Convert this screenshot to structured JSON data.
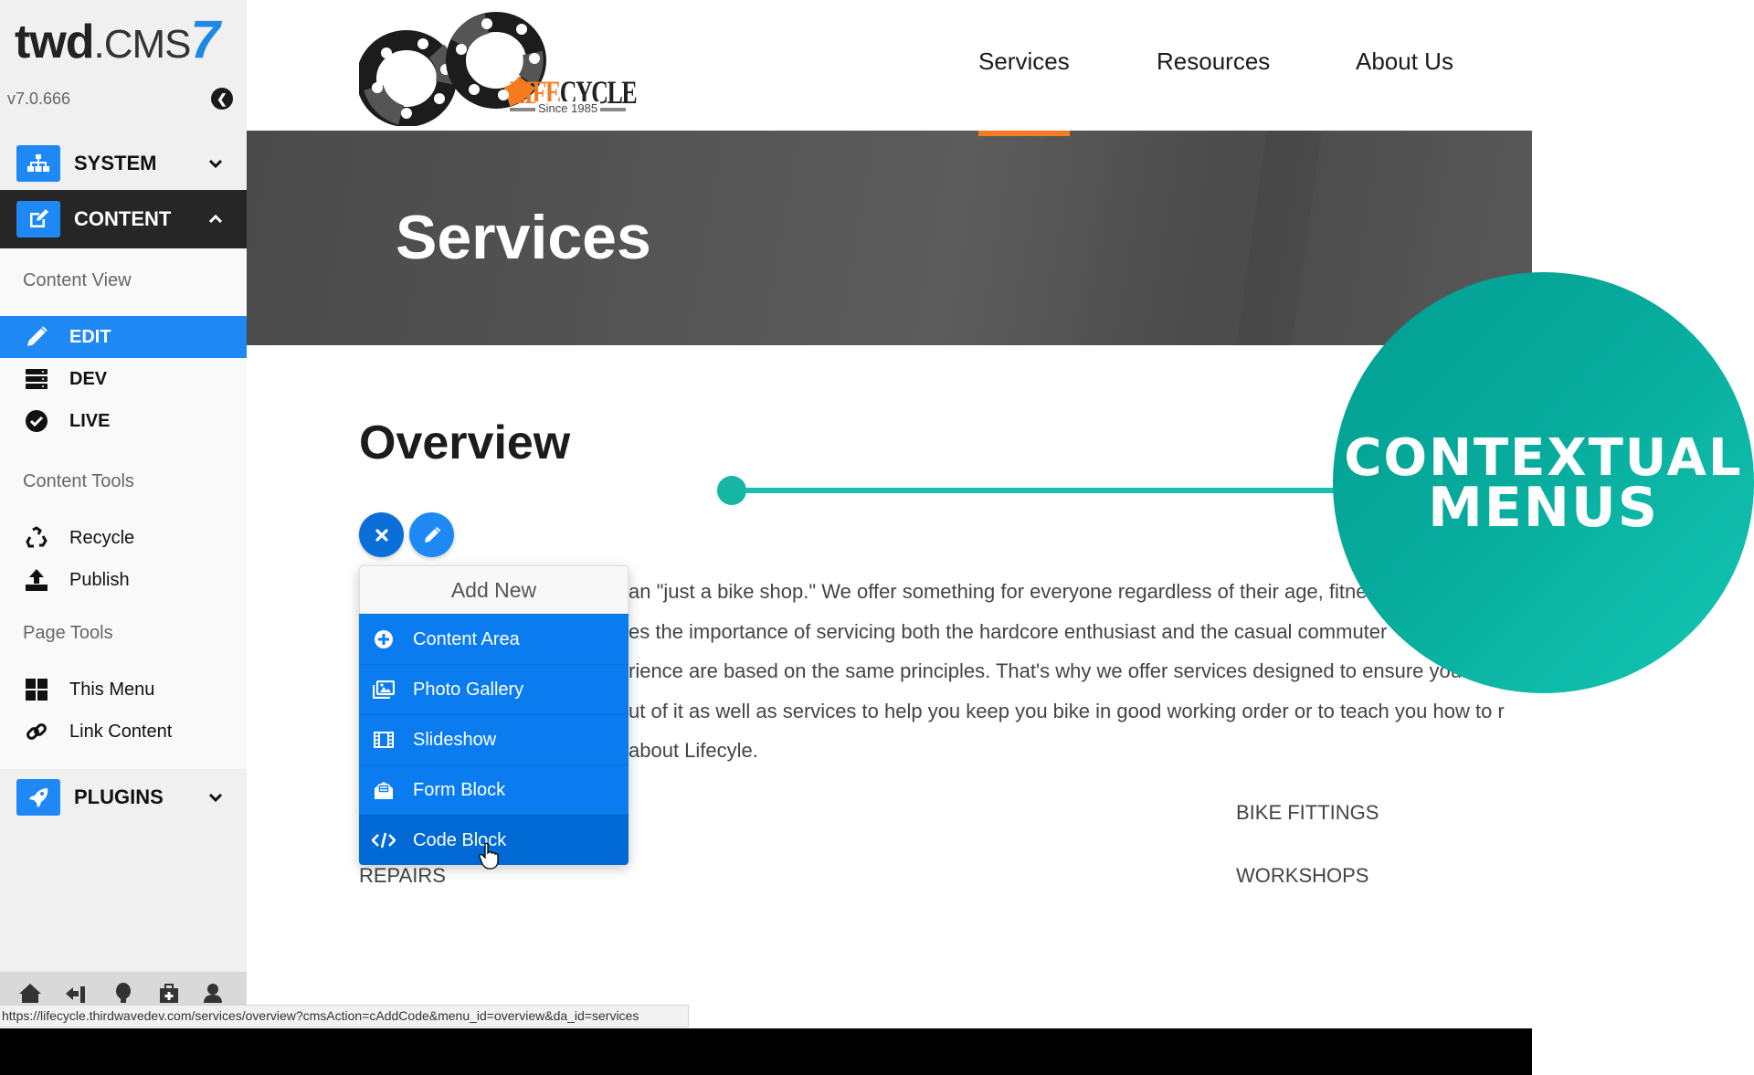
{
  "cms": {
    "logo_bold": "twd",
    "logo_light": ".CMS",
    "logo_number": "7",
    "version": "v7.0.666",
    "collapse_icon": "chevron-circle-left-icon"
  },
  "sidebar": {
    "sections": {
      "system": {
        "label": "SYSTEM",
        "icon": "sitemap-icon",
        "state": "collapsed"
      },
      "content": {
        "label": "CONTENT",
        "icon": "edit-square-icon",
        "state": "expanded"
      },
      "plugins": {
        "label": "PLUGINS",
        "icon": "rocket-icon",
        "state": "collapsed"
      }
    },
    "content_view": {
      "heading": "Content View",
      "items": [
        {
          "label": "EDIT",
          "icon": "pencil-icon",
          "active": true
        },
        {
          "label": "DEV",
          "icon": "server-icon",
          "active": false
        },
        {
          "label": "LIVE",
          "icon": "check-circle-icon",
          "active": false
        }
      ]
    },
    "content_tools": {
      "heading": "Content Tools",
      "items": [
        {
          "label": "Recycle",
          "icon": "recycle-icon"
        },
        {
          "label": "Publish",
          "icon": "upload-icon"
        }
      ]
    },
    "page_tools": {
      "heading": "Page Tools",
      "items": [
        {
          "label": "This Menu",
          "icon": "grid-icon"
        },
        {
          "label": "Link Content",
          "icon": "link-icon"
        }
      ]
    },
    "footer_icons": [
      "home-icon",
      "sign-in-icon",
      "lightbulb-icon",
      "medkit-icon",
      "user-icon"
    ]
  },
  "site": {
    "brand": {
      "name_orange": "LIFE",
      "name_dark": "CYCLE",
      "tagline": "Since 1985"
    },
    "nav": [
      {
        "label": "Services",
        "active": true
      },
      {
        "label": "Resources",
        "active": false
      },
      {
        "label": "About Us",
        "active": false
      }
    ],
    "accent_color": "#f47b20",
    "hero_title": "Services",
    "section_title": "Overview",
    "paragraph_lines": [
      "an \"just a bike shop.\"  We offer something for everyone regardless of their age, fitness level",
      "es the importance of servicing both the hardcore enthusiast and the casual commuter",
      "rience are based on the same principles.  That's why we offer services designed to ensure you",
      "ut of it as well as services to help you keep you bike in good working order or to teach you how to r",
      " about Lifecyle."
    ],
    "services": {
      "left": [
        "REPAIRS"
      ],
      "right": [
        "BIKE FITTINGS",
        "WORKSHOPS"
      ]
    }
  },
  "editor": {
    "close_button_icon": "close-icon",
    "edit_button_icon": "pencil-icon",
    "add_menu": {
      "title": "Add New",
      "items": [
        {
          "label": "Content Area",
          "icon": "plus-circle-icon"
        },
        {
          "label": "Photo Gallery",
          "icon": "images-icon"
        },
        {
          "label": "Slideshow",
          "icon": "film-icon"
        },
        {
          "label": "Form Block",
          "icon": "envelope-open-icon"
        },
        {
          "label": "Code Block",
          "icon": "code-icon",
          "hovered": true
        }
      ]
    }
  },
  "callout": {
    "line1": "CONTEXTUAL",
    "line2": "MENUS",
    "color": "#07ab9c"
  },
  "status_bar": {
    "url": "https://lifecycle.thirdwavedev.com/services/overview?cmsAction=cAddCode&menu_id=overview&da_id=services"
  }
}
